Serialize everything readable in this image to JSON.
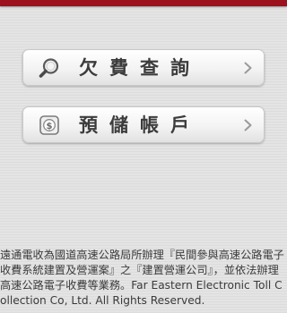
{
  "header": {
    "accent_color": "#9b111e"
  },
  "menu": {
    "items": [
      {
        "label": "欠費查詢",
        "icon": "search-icon",
        "chevron": "chevron-right-icon"
      },
      {
        "label": "預儲帳戶",
        "icon": "dollar-icon",
        "chevron": "chevron-right-icon"
      }
    ]
  },
  "footer": {
    "text": "遠通電收為國道高速公路局所辦理『民間參與高速公路電子收費系統建置及營運案』之『建置營運公司』，並依法辦理高速公路電子收費等業務。Far Eastern Electronic Toll Collection Co, Ltd. All Rights Reserved."
  }
}
